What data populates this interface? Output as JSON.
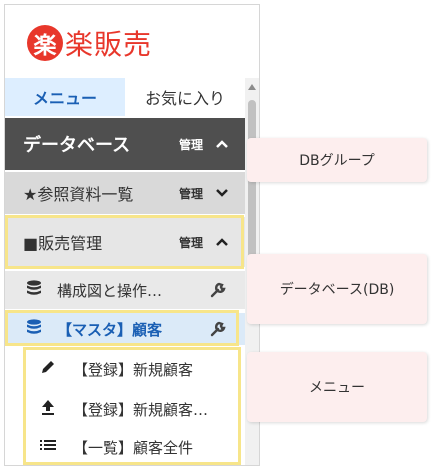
{
  "app": {
    "logo_char": "楽",
    "logo_text": "楽販売"
  },
  "tabs": [
    {
      "label": "メニュー",
      "active": true
    },
    {
      "label": "お気に入り",
      "active": false
    }
  ],
  "groups": {
    "db": {
      "label": "データベース",
      "manage": "管理",
      "expanded": true
    },
    "reference": {
      "label": "★参照資料一覧",
      "manage": "管理",
      "expanded": false
    },
    "sales": {
      "label": "■販売管理",
      "manage": "管理",
      "expanded": true
    }
  },
  "databases": [
    {
      "label": "構成図と操作…",
      "icon": "database-icon",
      "active": false
    },
    {
      "label": "【マスタ】顧客",
      "icon": "database-icon",
      "active": true
    }
  ],
  "menu_items": [
    {
      "label": "【登録】新規顧客",
      "icon": "pencil-icon"
    },
    {
      "label": "【登録】新規顧客…",
      "icon": "upload-icon"
    },
    {
      "label": "【一覧】顧客全件",
      "icon": "list-icon"
    }
  ],
  "callouts": {
    "db_group": "DBグループ",
    "database": "データベース(DB)",
    "menu": "メニュー"
  },
  "colors": {
    "brand": "#e8372b",
    "accent": "#1a5fb4",
    "highlight": "#f7e58a",
    "callout_bg": "#fdeeee"
  }
}
